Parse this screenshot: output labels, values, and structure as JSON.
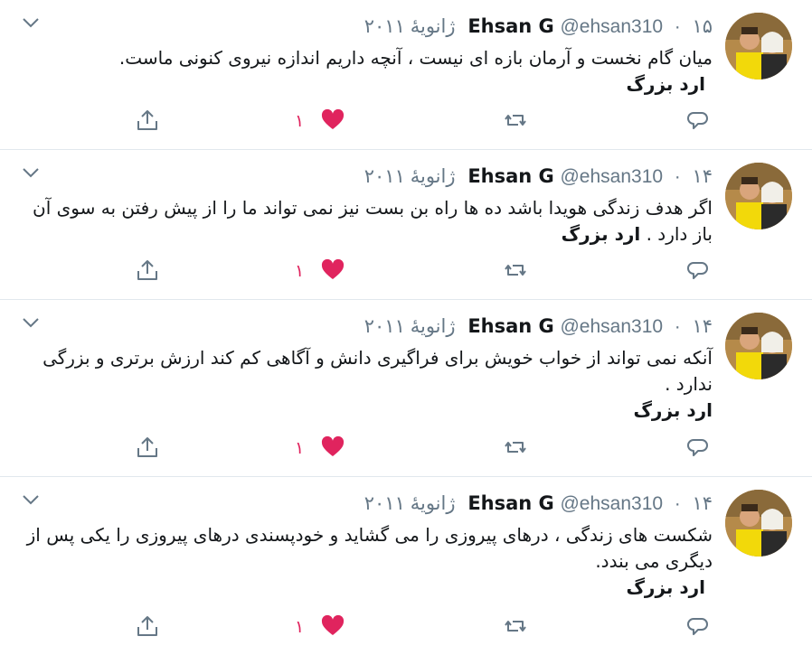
{
  "colors": {
    "text": "#14171a",
    "muted": "#657786",
    "like": "#e0245e",
    "divider": "#e1e8ed",
    "icon": "#657786"
  },
  "icons": {
    "reply": "reply-icon",
    "retweet": "retweet-icon",
    "like": "heart-icon",
    "share": "share-icon",
    "menu": "chevron-down-icon"
  },
  "tweets": [
    {
      "name": "Ehsan G",
      "handle": "@ehsan310",
      "date": "۱۵ ژانویهٔ ۲۰۱۱",
      "text": "میان گام نخست و آرمان بازه ای نیست ، آنچه داریم  اندازه نیروی کنونی ماست.",
      "signature": "ارد بزرگ",
      "likes": "۱"
    },
    {
      "name": "Ehsan G",
      "handle": "@ehsan310",
      "date": "۱۴ ژانویهٔ ۲۰۱۱",
      "text": "اگر هدف زندگی هویدا باشد ده ها راه بن بست نیز نمی تواند ما را از پیش رفتن به سوی آن باز  دارد .",
      "signature": "ارد بزرگ",
      "likes": "۱"
    },
    {
      "name": "Ehsan G",
      "handle": "@ehsan310",
      "date": "۱۴ ژانویهٔ ۲۰۱۱",
      "text": "آنکه نمی تواند از خواب خویش برای فراگیری دانش و آگاهی کم کند ارزش برتری و بزرگی ندارد .",
      "signature": "ارد بزرگ",
      "likes": "۱"
    },
    {
      "name": "Ehsan G",
      "handle": "@ehsan310",
      "date": "۱۴ ژانویهٔ ۲۰۱۱",
      "text": "شکست های زندگی ، درهای پیروزی را  می گشاید و خودپسندی درهای پیروزی را یکی پس از دیگری می بندد.",
      "signature": "ارد بزرگ",
      "likes": "۱"
    }
  ]
}
